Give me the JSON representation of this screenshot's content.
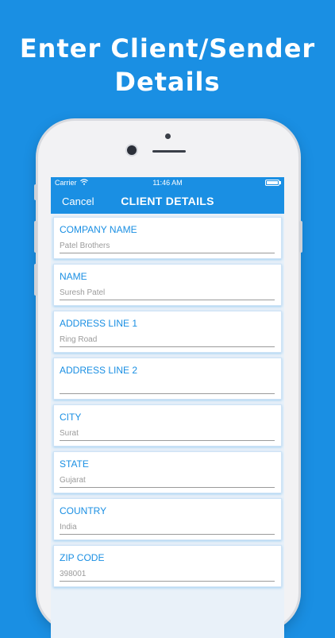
{
  "headline": {
    "line1": "Enter Client/Sender",
    "line2": "Details"
  },
  "status_bar": {
    "carrier": "Carrier",
    "time": "11:46 AM"
  },
  "nav": {
    "cancel_label": "Cancel",
    "title": "CLIENT DETAILS"
  },
  "fields": [
    {
      "label": "COMPANY NAME",
      "value": "Patel Brothers"
    },
    {
      "label": "NAME",
      "value": "Suresh Patel"
    },
    {
      "label": "ADDRESS LINE 1",
      "value": "Ring Road"
    },
    {
      "label": "ADDRESS LINE 2",
      "value": ""
    },
    {
      "label": "CITY",
      "value": "Surat"
    },
    {
      "label": "STATE",
      "value": "Gujarat"
    },
    {
      "label": "COUNTRY",
      "value": "India"
    },
    {
      "label": "ZIP CODE",
      "value": "398001"
    }
  ],
  "colors": {
    "accent": "#1a8fe3",
    "background": "#1a8fe3",
    "label": "#1a8fe3"
  },
  "icons": {
    "wifi": "wifi-icon",
    "battery": "battery-icon"
  }
}
